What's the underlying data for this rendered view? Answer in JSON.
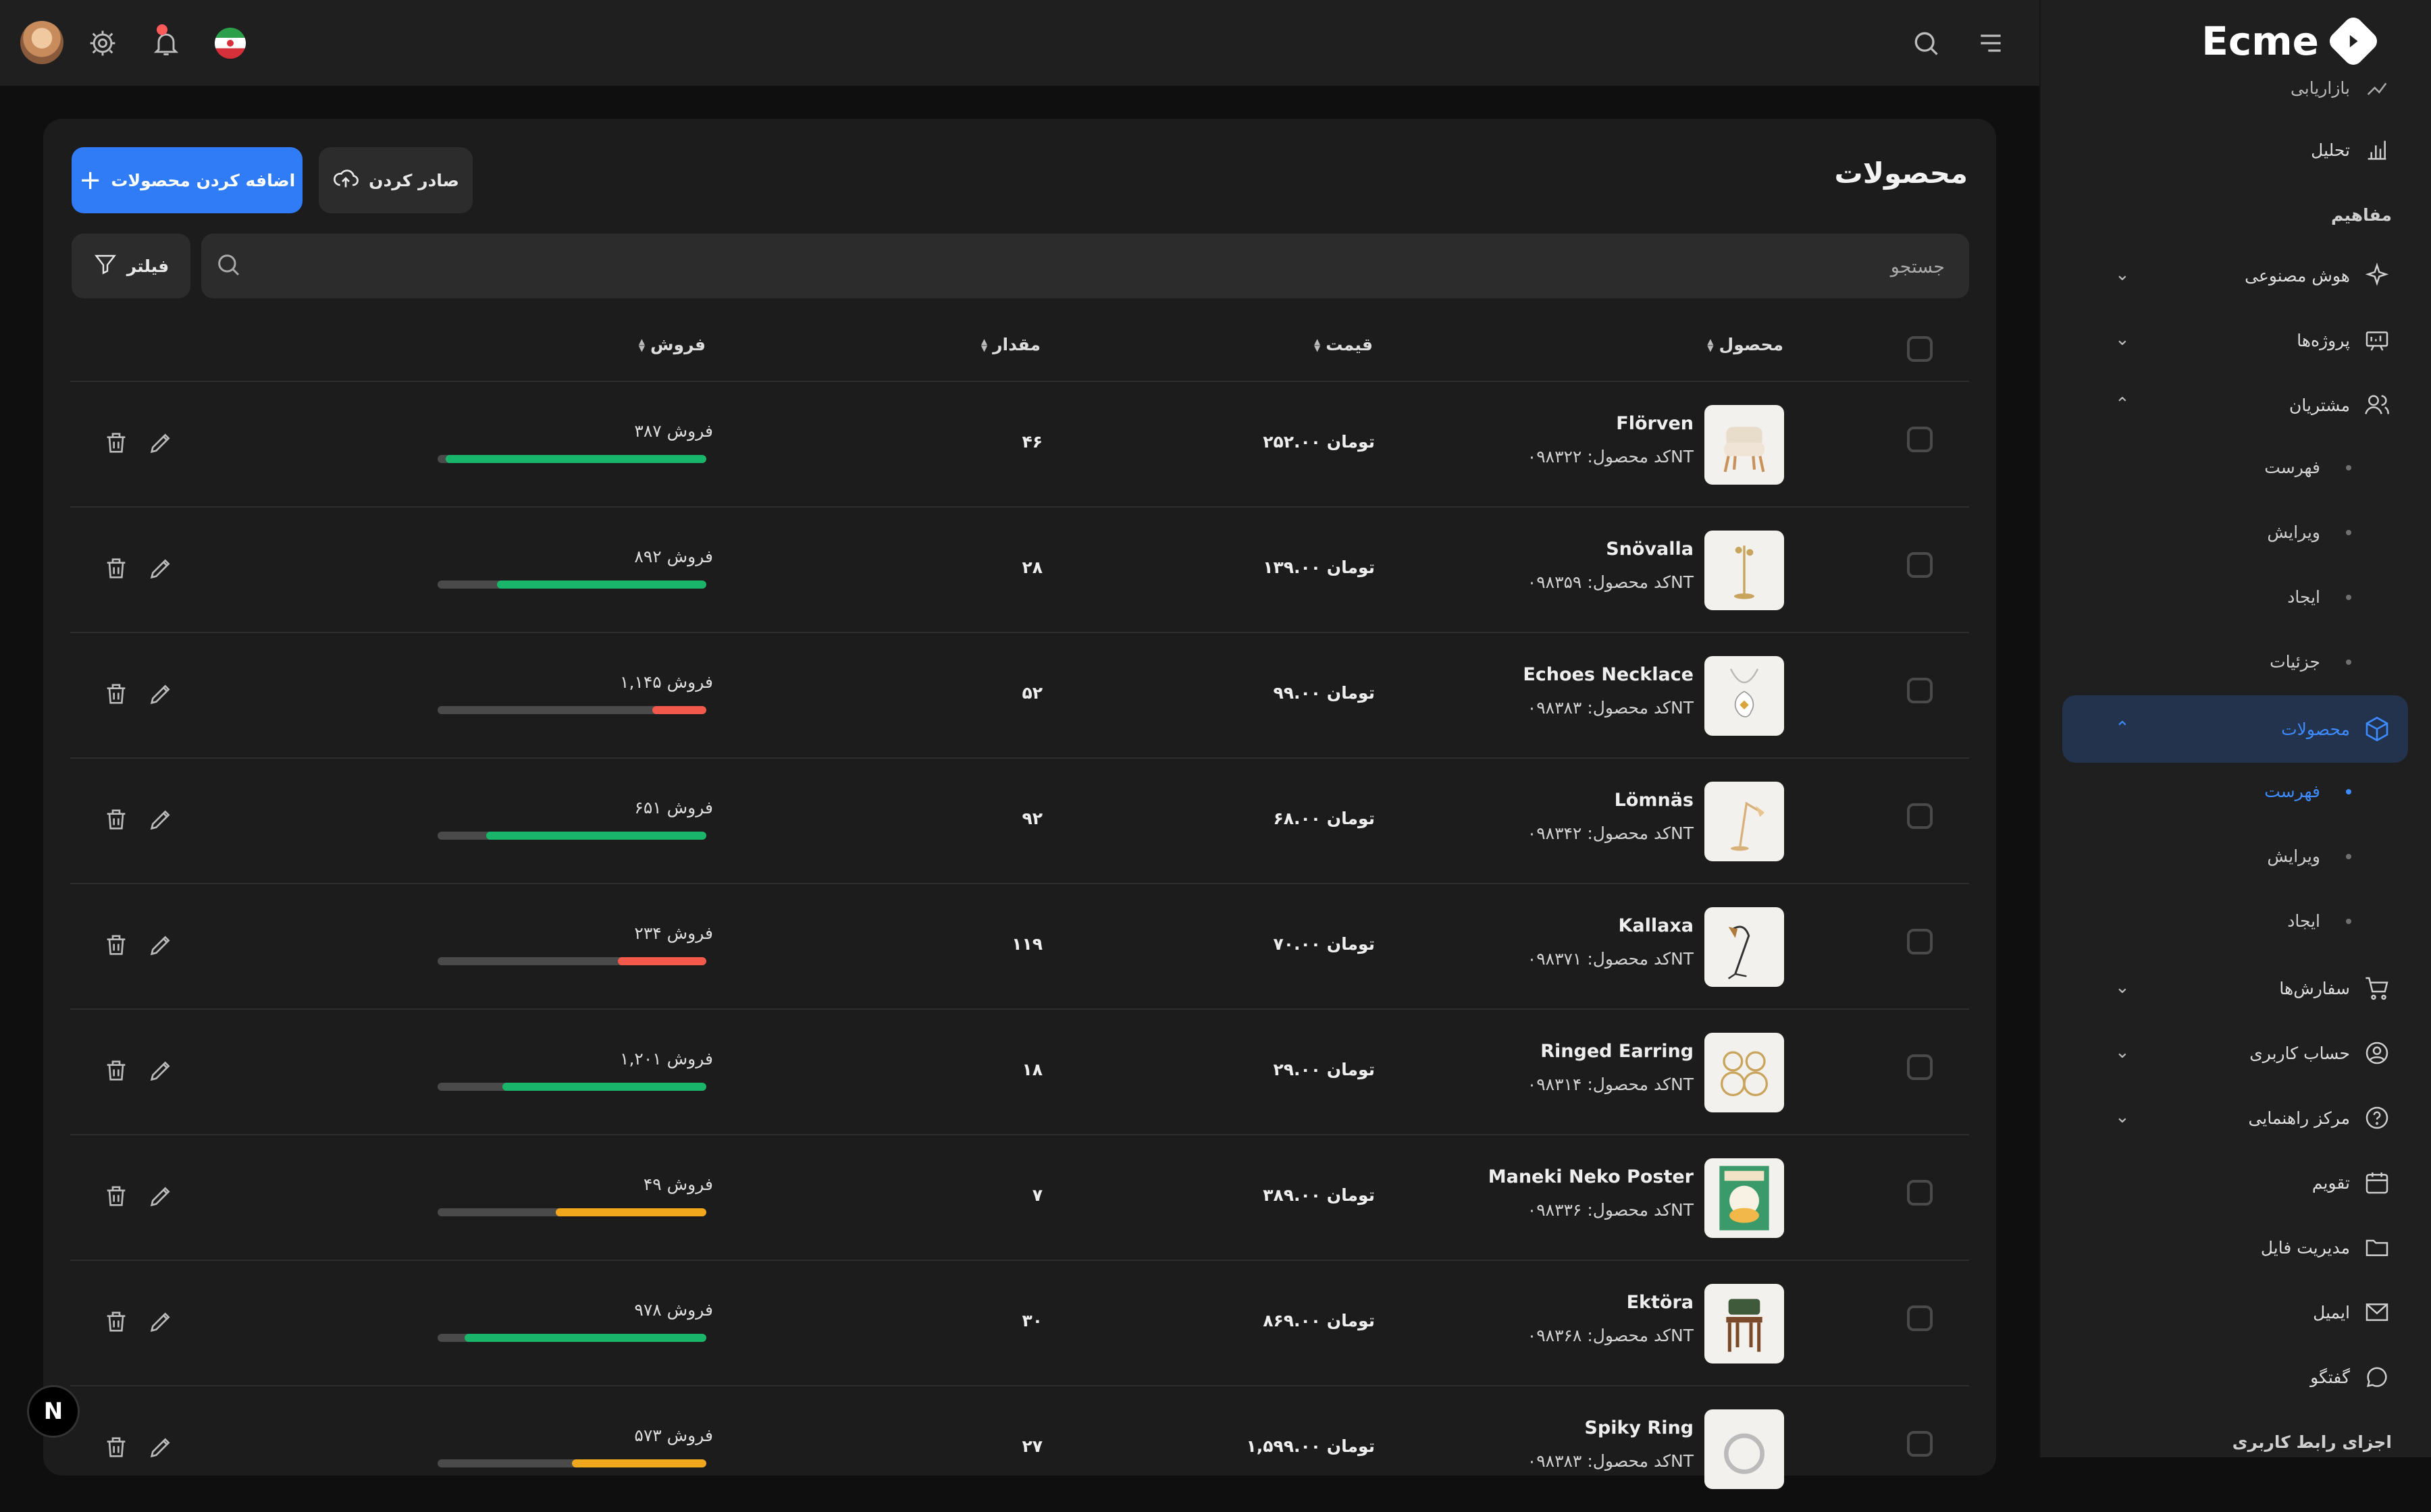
{
  "app": {
    "logo": "Ecme"
  },
  "topbar": {
    "icons": [
      "avatar",
      "gear-icon",
      "bell-icon",
      "flag-icon",
      "search-icon",
      "menu-icon"
    ],
    "notification_color": "#ff5a5a"
  },
  "sidebar": {
    "partial_top": "بازاریابی",
    "analytics": "تحلیل",
    "concepts_header": "مفاهیم",
    "groups": [
      {
        "label": "هوش مصنوعی",
        "icon": "sparkle-icon"
      },
      {
        "label": "پروژه‌ها",
        "icon": "projects-icon"
      },
      {
        "label": "مشتریان",
        "icon": "users-icon"
      }
    ],
    "customers_sub": [
      "فهرست",
      "ویرایش",
      "ایجاد",
      "جزئیات"
    ],
    "products": {
      "label": "محصولات",
      "icon": "box-icon",
      "active_color": "#3d8bff"
    },
    "products_sub": [
      {
        "label": "فهرست",
        "active": true
      },
      {
        "label": "ویرایش",
        "active": false
      },
      {
        "label": "ایجاد",
        "active": false
      }
    ],
    "more_groups": [
      {
        "label": "سفارش‌ها",
        "icon": "cart-icon"
      },
      {
        "label": "حساب کاربری",
        "icon": "user-circle-icon"
      },
      {
        "label": "مرکز راهنمایی",
        "icon": "help-icon"
      }
    ],
    "links": [
      {
        "label": "تقویم",
        "icon": "calendar-icon"
      },
      {
        "label": "مدیریت فایل",
        "icon": "folder-icon"
      },
      {
        "label": "ایمیل",
        "icon": "mail-icon"
      },
      {
        "label": "گفتگو",
        "icon": "chat-icon"
      }
    ],
    "bottom_header": "اجزای رابط کاربری"
  },
  "page": {
    "title": "محصولات",
    "add_button": "اضافه کردن محصولات",
    "export_button": "صادر کردن",
    "filter_button": "فیلتر",
    "search_placeholder": "جستجو",
    "accent": "#2f7cf6"
  },
  "table": {
    "columns": {
      "product": "محصول",
      "price": "قیمت",
      "quantity": "مقدار",
      "sales": "فروش"
    },
    "rows": [
      {
        "name": "Flörven",
        "code": "کد محصول: ۰۹۸۳۲۲NT",
        "price": "۲۵۲.۰۰ تومان",
        "qty": "۴۶",
        "sales": "۳۸۷ فروش",
        "progress": 0.97,
        "color": "#19b56a",
        "thumb": "chair"
      },
      {
        "name": "Snövalla",
        "code": "کد محصول: ۰۹۸۳۵۹NT",
        "price": "۱۳۹.۰۰ تومان",
        "qty": "۲۸",
        "sales": "۸۹۲ فروش",
        "progress": 0.78,
        "color": "#19b56a",
        "thumb": "lamp"
      },
      {
        "name": "Echoes Necklace",
        "code": "کد محصول: ۰۹۸۳۸۳NT",
        "price": "۹۹.۰۰ تومان",
        "qty": "۵۲",
        "sales": "۱,۱۴۵ فروش",
        "progress": 0.2,
        "color": "#f2594b",
        "thumb": "necklace"
      },
      {
        "name": "Lömnäs",
        "code": "کد محصول: ۰۹۸۳۴۲NT",
        "price": "۶۸.۰۰ تومان",
        "qty": "۹۲",
        "sales": "۶۵۱ فروش",
        "progress": 0.82,
        "color": "#19b56a",
        "thumb": "floorlamp"
      },
      {
        "name": "Kallaxa",
        "code": "کد محصول: ۰۹۸۳۷۱NT",
        "price": "۷۰.۰۰ تومان",
        "qty": "۱۱۹",
        "sales": "۲۳۴ فروش",
        "progress": 0.33,
        "color": "#f2594b",
        "thumb": "arclamp"
      },
      {
        "name": "Ringed Earring",
        "code": "کد محصول: ۰۹۸۳۱۴NT",
        "price": "۲۹.۰۰ تومان",
        "qty": "۱۸",
        "sales": "۱,۲۰۱ فروش",
        "progress": 0.76,
        "color": "#19b56a",
        "thumb": "earring"
      },
      {
        "name": "Maneki Neko Poster",
        "code": "کد محصول: ۰۹۸۳۳۶NT",
        "price": "۳۸۹.۰۰ تومان",
        "qty": "۷",
        "sales": "۴۹ فروش",
        "progress": 0.56,
        "color": "#f2a81c",
        "thumb": "poster"
      },
      {
        "name": "Ektöra",
        "code": "کد محصول: ۰۹۸۳۶۸NT",
        "price": "۸۶۹.۰۰ تومان",
        "qty": "۳۰",
        "sales": "۹۷۸ فروش",
        "progress": 0.9,
        "color": "#19b56a",
        "thumb": "stool"
      },
      {
        "name": "Spiky Ring",
        "code": "کد محصول: ۰۹۸۳۸۳NT",
        "price": "۱,۵۹۹.۰۰ تومان",
        "qty": "۲۷",
        "sales": "۵۷۳ فروش",
        "progress": 0.5,
        "color": "#f2a81c",
        "thumb": "ring"
      }
    ]
  },
  "badge": {
    "letter": "N"
  }
}
